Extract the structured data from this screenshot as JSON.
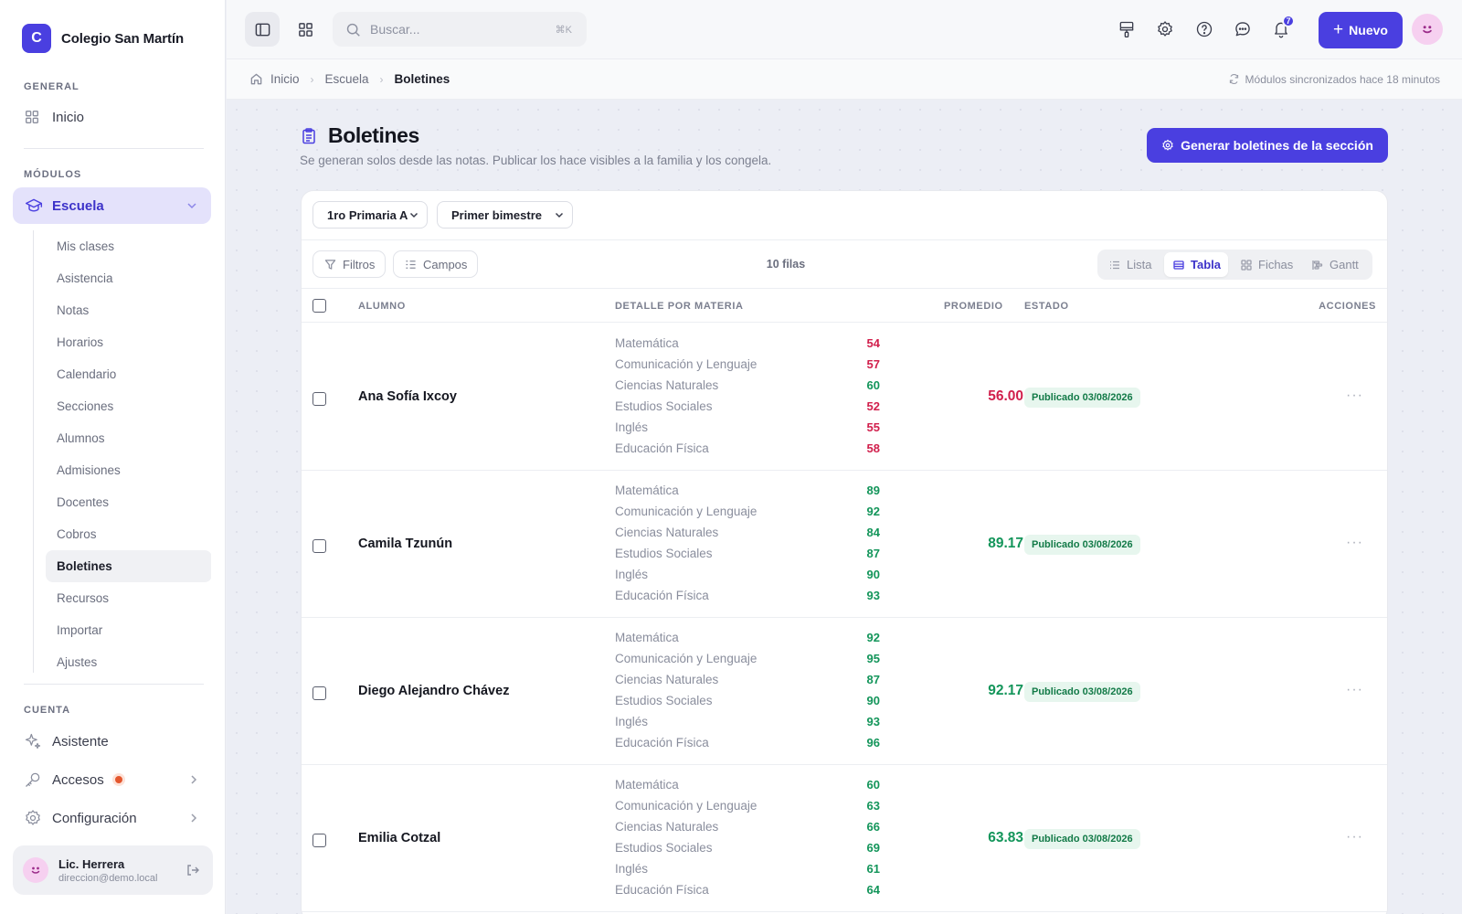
{
  "brand": {
    "initial": "C",
    "name": "Colegio San Martín"
  },
  "sidebar": {
    "general_label": "GENERAL",
    "inicio": "Inicio",
    "modulos_label": "MÓDULOS",
    "escuela": "Escuela",
    "sub_items": [
      "Mis clases",
      "Asistencia",
      "Notas",
      "Horarios",
      "Calendario",
      "Secciones",
      "Alumnos",
      "Admisiones",
      "Docentes",
      "Cobros",
      "Boletines",
      "Recursos",
      "Importar",
      "Ajustes"
    ],
    "active_sub": "Boletines",
    "cuenta_label": "CUENTA",
    "asistente": "Asistente",
    "accesos": "Accesos",
    "configuracion": "Configuración",
    "user": {
      "name": "Lic. Herrera",
      "email": "direccion@demo.local"
    }
  },
  "topbar": {
    "search_placeholder": "Buscar...",
    "search_kbd": "⌘K",
    "notif_count": "7",
    "nuevo": "Nuevo"
  },
  "breadcrumb": {
    "items": [
      "Inicio",
      "Escuela",
      "Boletines"
    ],
    "sync": "Módulos sincronizados hace 18 minutos"
  },
  "page": {
    "title": "Boletines",
    "subtitle": "Se generan solos desde las notas. Publicar los hace visibles a la familia y los congela.",
    "generate_button": "Generar boletines de la sección"
  },
  "filters": {
    "section": "1ro Primaria A",
    "period": "Primer bimestre"
  },
  "toolbar": {
    "filtros": "Filtros",
    "campos": "Campos",
    "row_count": "10 filas",
    "views": [
      "Lista",
      "Tabla",
      "Fichas",
      "Gantt"
    ],
    "active_view": "Tabla"
  },
  "table": {
    "headers": {
      "alumno": "ALUMNO",
      "detalle": "DETALLE POR MATERIA",
      "promedio": "PROMEDIO",
      "estado": "ESTADO",
      "acciones": "ACCIONES"
    },
    "subjects": [
      "Matemática",
      "Comunicación y Lenguaje",
      "Ciencias Naturales",
      "Estudios Sociales",
      "Inglés",
      "Educación Física"
    ],
    "rows": [
      {
        "name": "Ana Sofía Ixcoy",
        "grades": [
          "54",
          "57",
          "60",
          "52",
          "55",
          "58"
        ],
        "average": "56.00",
        "status": "Publicado 03/08/2026"
      },
      {
        "name": "Camila Tzunún",
        "grades": [
          "89",
          "92",
          "84",
          "87",
          "90",
          "93"
        ],
        "average": "89.17",
        "status": "Publicado 03/08/2026"
      },
      {
        "name": "Diego Alejandro Chávez",
        "grades": [
          "92",
          "95",
          "87",
          "90",
          "93",
          "96"
        ],
        "average": "92.17",
        "status": "Publicado 03/08/2026"
      },
      {
        "name": "Emilia Cotzal",
        "grades": [
          "60",
          "63",
          "66",
          "69",
          "61",
          "64"
        ],
        "average": "63.83",
        "status": "Publicado 03/08/2026"
      }
    ],
    "more_label": "···"
  },
  "colors": {
    "accent": "#4a3fe0",
    "fail": "#d11f4c",
    "pass": "#13955a",
    "badge_bg": "#e7f6ee"
  }
}
